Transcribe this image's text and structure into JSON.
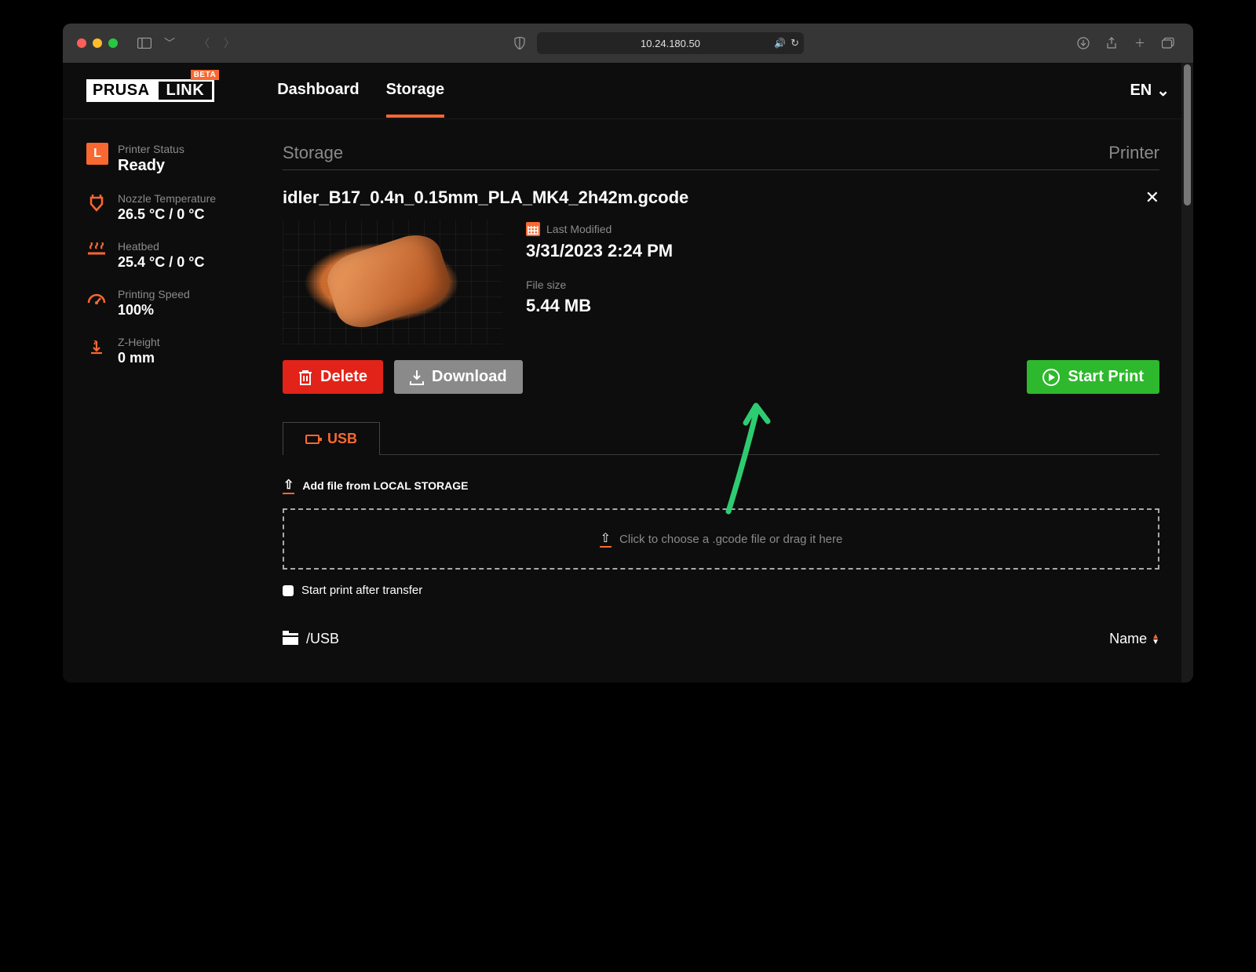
{
  "browser": {
    "address": "10.24.180.50"
  },
  "header": {
    "logo_a": "PRUSA",
    "logo_b": "LINK",
    "beta": "BETA",
    "nav_dashboard": "Dashboard",
    "nav_storage": "Storage",
    "lang": "EN"
  },
  "sidebar": {
    "status_badge": "L",
    "status_label": "Printer Status",
    "status_value": "Ready",
    "nozzle_label": "Nozzle Temperature",
    "nozzle_value": "26.5 °C / 0 °C",
    "heatbed_label": "Heatbed",
    "heatbed_value": "25.4 °C / 0 °C",
    "speed_label": "Printing Speed",
    "speed_value": "100%",
    "z_label": "Z-Height",
    "z_value": "0 mm"
  },
  "page": {
    "title_left": "Storage",
    "title_right": "Printer",
    "file_name": "idler_B17_0.4n_0.15mm_PLA_MK4_2h42m.gcode",
    "modified_label": "Last Modified",
    "modified_value": "3/31/2023 2:24 PM",
    "size_label": "File size",
    "size_value": "5.44 MB",
    "btn_delete": "Delete",
    "btn_download": "Download",
    "btn_start": "Start Print",
    "tab_usb": "USB",
    "add_file": "Add file from LOCAL STORAGE",
    "dropzone": "Click to choose a .gcode file or drag it here",
    "checkbox": "Start print after transfer",
    "folder_path": "/USB",
    "sort_label": "Name"
  }
}
